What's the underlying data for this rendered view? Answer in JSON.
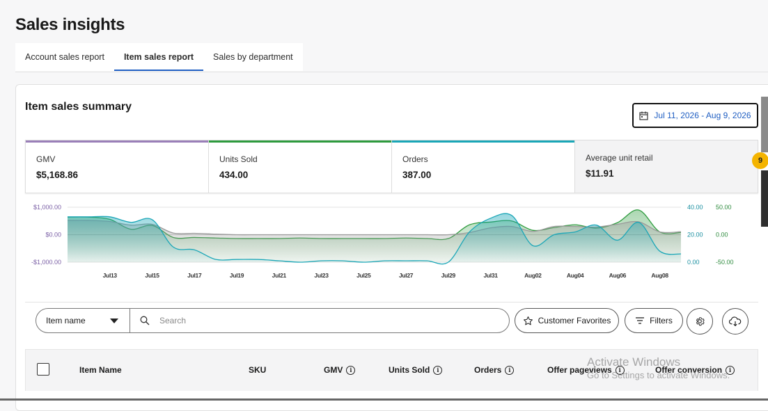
{
  "page": {
    "title": "Sales insights"
  },
  "tabs": [
    {
      "label": "Account sales report",
      "active": false
    },
    {
      "label": "Item sales report",
      "active": true
    },
    {
      "label": "Sales by department",
      "active": false
    }
  ],
  "summary": {
    "title": "Item sales summary",
    "date_range": "Jul 11, 2026 - Aug 9, 2026",
    "metrics": [
      {
        "label": "GMV",
        "value": "$5,168.86",
        "color": "#9a7fb8"
      },
      {
        "label": "Units Sold",
        "value": "434.00",
        "color": "#2e9b3e"
      },
      {
        "label": "Orders",
        "value": "387.00",
        "color": "#1aa6b7"
      },
      {
        "label": "Average unit retail",
        "value": "$11.91",
        "color": "#f3f3f4"
      }
    ]
  },
  "chart_data": {
    "type": "area",
    "x_labels": [
      "Jul 13",
      "Jul 15",
      "Jul 17",
      "Jul 19",
      "Jul 21",
      "Jul 23",
      "Jul 25",
      "Jul 27",
      "Jul 29",
      "Jul 31",
      "Aug 02",
      "Aug 04",
      "Aug 06",
      "Aug 08"
    ],
    "y_left": {
      "ticks": [
        "$1,000.00",
        "$0.00",
        "-$1,000.00"
      ],
      "range": [
        -1000,
        1000
      ]
    },
    "y_right_1": {
      "ticks": [
        "40.00",
        "20.00",
        "0.00"
      ],
      "range": [
        0,
        40
      ]
    },
    "y_right_2": {
      "ticks": [
        "50.00",
        "0.00",
        "-50.00"
      ],
      "range": [
        -50,
        50
      ]
    },
    "x": [
      11,
      12,
      13,
      14,
      15,
      16,
      17,
      18,
      19,
      20,
      21,
      22,
      23,
      24,
      25,
      26,
      27,
      28,
      29,
      30,
      31,
      32,
      33,
      34,
      35,
      36,
      37,
      38,
      39,
      40
    ],
    "series": [
      {
        "color": "#9a9a9a",
        "axis": "y_left",
        "values": [
          520,
          520,
          480,
          350,
          380,
          60,
          50,
          20,
          0,
          0,
          0,
          0,
          0,
          0,
          0,
          0,
          0,
          0,
          0,
          80,
          250,
          300,
          120,
          300,
          300,
          280,
          380,
          470,
          100,
          110
        ]
      },
      {
        "color": "#2e9b3e",
        "axis": "y_right_2",
        "values": [
          32,
          32,
          28,
          10,
          17,
          -5,
          -5,
          -6,
          -7,
          -7,
          -7,
          -6,
          -7,
          -7,
          -7,
          -7,
          -6,
          -7,
          -7,
          18,
          23,
          25,
          8,
          13,
          18,
          12,
          22,
          45,
          5,
          4
        ]
      },
      {
        "color": "#1aa6b7",
        "axis": "y_right_1",
        "values": [
          33,
          33,
          33,
          29,
          31,
          11,
          9,
          2,
          2,
          2,
          1,
          0,
          1,
          1,
          0,
          1,
          1,
          1,
          0,
          22,
          32,
          34,
          12,
          20,
          22,
          27,
          16,
          29,
          8,
          6
        ]
      }
    ]
  },
  "filters": {
    "item_select": "Item name",
    "search_placeholder": "Search",
    "customer_favorites": "Customer Favorites",
    "filters": "Filters"
  },
  "table": {
    "columns": [
      "Item Name",
      "SKU",
      "GMV",
      "Units Sold",
      "Orders",
      "Offer pageviews",
      "Offer conversion"
    ]
  },
  "side": {
    "badge": "9"
  },
  "watermark": {
    "line1": "Activate Windows",
    "line2": "Go to Settings to activate Windows."
  }
}
